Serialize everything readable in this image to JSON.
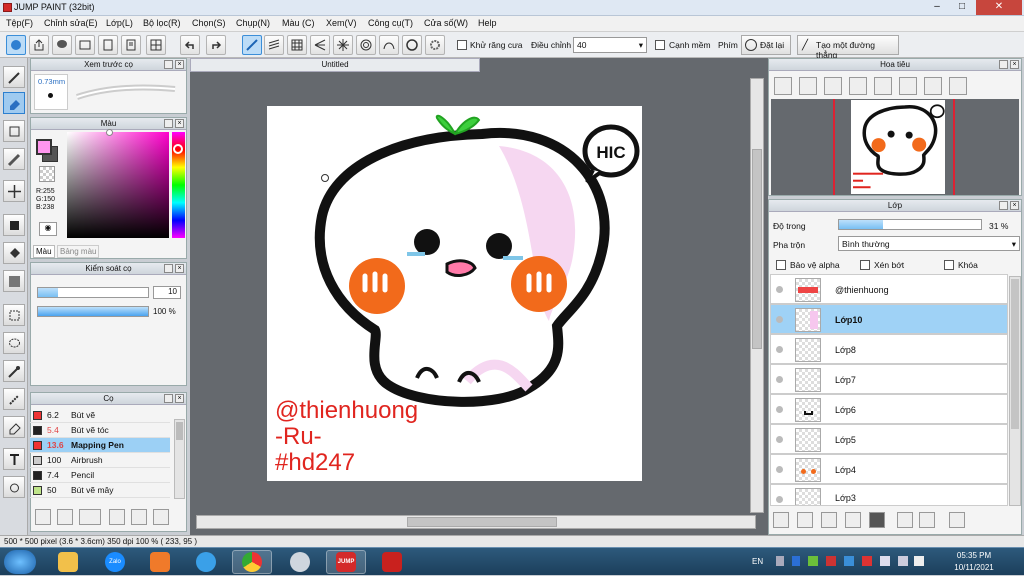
{
  "window": {
    "title": "JUMP PAINT (32bit)"
  },
  "menu": [
    "Tệp(F)",
    "Chỉnh sửa(E)",
    "Lớp(L)",
    "Bộ lọc(R)",
    "Chọn(S)",
    "Chụp(N)",
    "Màu (C)",
    "Xem(V)",
    "Công cụ(T)",
    "Cửa số(W)",
    "Help"
  ],
  "toolbar": {
    "antialias_label": "Khử răng cưa",
    "strength_label": "Điều chỉnh",
    "strength_value": "40",
    "brush_limit_label": "Cạnh mềm",
    "key_label": "Phím",
    "reset_label": "Đặt lại",
    "straight_line_label": "Tạo một đường thẳng"
  },
  "brush_preview": {
    "title": "Xem trước cọ",
    "size": "0.73mm"
  },
  "color": {
    "title": "Màu",
    "r": "R:255",
    "g": "G:150",
    "b": "B:238",
    "tab_color": "Màu",
    "tab_palette": "Bảng màu",
    "main": "#ff96ee"
  },
  "brush_control": {
    "title": "Kiểm soát cọ",
    "size_value": "10",
    "density_value": "100 %"
  },
  "brushes": {
    "title": "Cọ",
    "items": [
      {
        "size": "6.2",
        "name": "Bút vẽ",
        "color": "#e33"
      },
      {
        "size": "5.4",
        "name": "Bút vẽ tóc",
        "color": "#222"
      },
      {
        "size": "13.6",
        "name": "Mapping Pen",
        "color": "#e33"
      },
      {
        "size": "100",
        "name": "Airbrush",
        "color": "#ccc"
      },
      {
        "size": "7.4",
        "name": "Pencil",
        "color": "#222"
      },
      {
        "size": "50",
        "name": "Bút vẽ mây",
        "color": "#bfe58a"
      }
    ]
  },
  "document": {
    "tab_title": "Untitled"
  },
  "artwork": {
    "bubble_text": "HIC",
    "watermark": [
      "@thienhuong",
      "-Ru-",
      "#hd247"
    ]
  },
  "navigator": {
    "title": "Hoa tiêu"
  },
  "layers": {
    "title": "Lớp",
    "opacity_label": "Độ trong",
    "opacity_value": "31 %",
    "opacity_fraction": 0.31,
    "blend_label": "Pha trộn",
    "blend_value": "Bình thường",
    "protect_alpha_label": "Bảo vệ alpha",
    "clip_label": "Xén bớt",
    "lock_label": "Khóa",
    "items": [
      "@thienhuong",
      "Lớp10",
      "Lớp8",
      "Lớp7",
      "Lớp6",
      "Lớp5",
      "Lớp4",
      "Lớp3"
    ],
    "selected": "Lớp10"
  },
  "status": {
    "text": "500 * 500 pixel   (3.6 * 3.6cm)   350 dpi   100 %   ( 233, 95 )"
  },
  "taskbar": {
    "lang": "EN",
    "time": "05:35 PM",
    "date": "10/11/2021",
    "zalo": "Zalo",
    "jump": "JUMP"
  }
}
